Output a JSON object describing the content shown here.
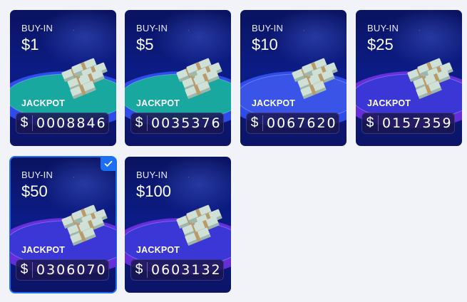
{
  "colors": {
    "page_bg": "#f1f3f8",
    "card_bg": "#0c1c86",
    "selected_accent": "#1b6ff5",
    "table_teal": "#19a8a0",
    "table_blue": "#2f4ff0",
    "table_purple": "#6b2fe0"
  },
  "icons": {
    "money": "money-stack-icon",
    "check": "check-icon"
  },
  "cards": [
    {
      "buyin_label": "BUY-IN",
      "buyin_amount": "$1",
      "jackpot_label": "JACKPOT",
      "currency": "$",
      "jackpot_value": "0008846",
      "table": "teal",
      "selected": false
    },
    {
      "buyin_label": "BUY-IN",
      "buyin_amount": "$5",
      "jackpot_label": "JACKPOT",
      "currency": "$",
      "jackpot_value": "0035376",
      "table": "teal",
      "selected": false
    },
    {
      "buyin_label": "BUY-IN",
      "buyin_amount": "$10",
      "jackpot_label": "JACKPOT",
      "currency": "$",
      "jackpot_value": "0067620",
      "table": "blue",
      "selected": false
    },
    {
      "buyin_label": "BUY-IN",
      "buyin_amount": "$25",
      "jackpot_label": "JACKPOT",
      "currency": "$",
      "jackpot_value": "0157359",
      "table": "purple",
      "selected": false
    },
    {
      "buyin_label": "BUY-IN",
      "buyin_amount": "$50",
      "jackpot_label": "JACKPOT",
      "currency": "$",
      "jackpot_value": "0306070",
      "table": "purple",
      "selected": true
    },
    {
      "buyin_label": "BUY-IN",
      "buyin_amount": "$100",
      "jackpot_label": "JACKPOT",
      "currency": "$",
      "jackpot_value": "0603132",
      "table": "purple",
      "selected": false
    }
  ]
}
